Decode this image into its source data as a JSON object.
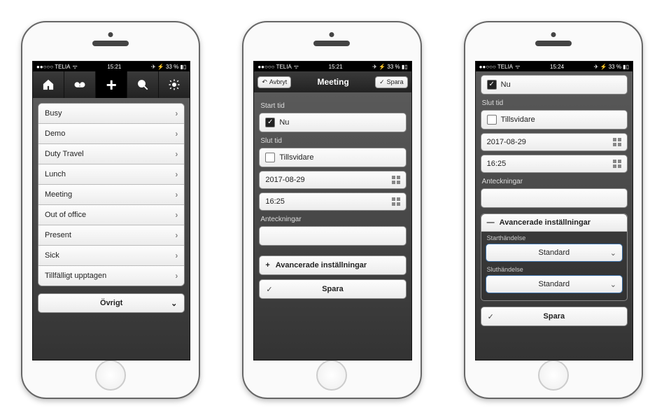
{
  "status": {
    "carrier": "●●○○○ TELIA",
    "wifi": "ᯤ",
    "time1": "15:21",
    "time2": "15:21",
    "time3": "15:24",
    "right": "✈ ⚡ 33 % ▮▯"
  },
  "screen1": {
    "activities": [
      "Busy",
      "Demo",
      "Duty Travel",
      "Lunch",
      "Meeting",
      "Out of office",
      "Present",
      "Sick",
      "Tillfälligt upptagen"
    ],
    "other_label": "Övrigt"
  },
  "screen2": {
    "nav_cancel": "Avbryt",
    "nav_title": "Meeting",
    "nav_save": "Spara",
    "start_label": "Start tid",
    "now_label": "Nu",
    "end_label": "Slut tid",
    "until_label": "Tillsvidare",
    "date_value": "2017-08-29",
    "time_value": "16:25",
    "notes_label": "Anteckningar",
    "notes_value": "",
    "advanced_label": "Avancerade inställningar",
    "save_label": "Spara"
  },
  "screen3": {
    "now_label": "Nu",
    "end_label": "Slut tid",
    "until_label": "Tillsvidare",
    "date_value": "2017-08-29",
    "time_value": "16:25",
    "notes_label": "Anteckningar",
    "notes_value": "",
    "advanced_label": "Avancerade inställningar",
    "start_event_label": "Starthändelse",
    "start_event_value": "Standard",
    "end_event_label": "Sluthändelse",
    "end_event_value": "Standard",
    "save_label": "Spara"
  }
}
